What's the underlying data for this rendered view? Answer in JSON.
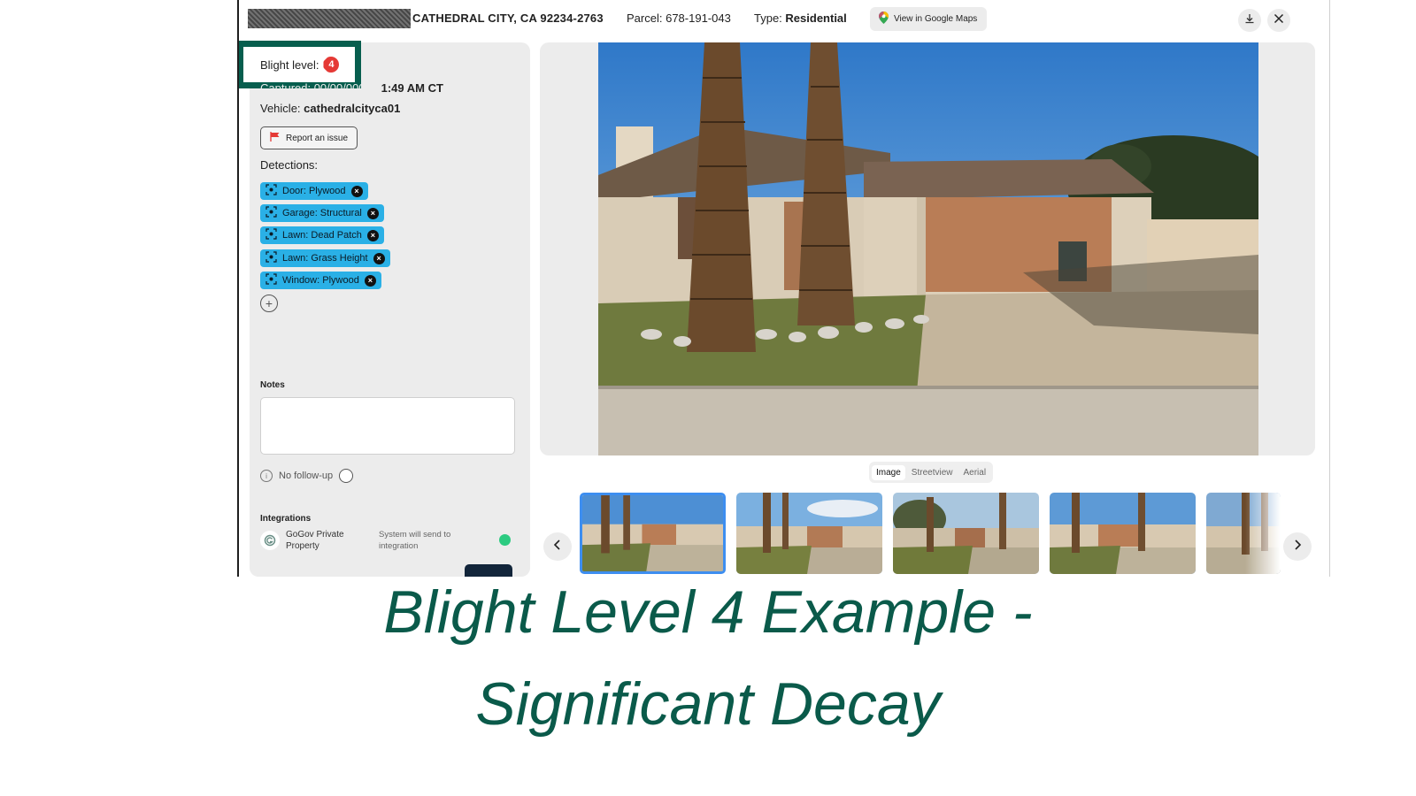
{
  "header": {
    "address": "CATHEDRAL CITY, CA 92234-2763",
    "parcel_label": "Parcel:",
    "parcel_value": "678-191-043",
    "type_label": "Type:",
    "type_value": "Residential",
    "maps_button": "View in Google Maps"
  },
  "panel": {
    "blight_label": "Blight level:",
    "blight_value": "4",
    "time_visible": "1:49 AM CT",
    "vehicle_label": "Vehicle:",
    "vehicle_value": "cathedralcityca01",
    "report_button": "Report an issue",
    "detections_label": "Detections:",
    "detections": [
      "Door: Plywood",
      "Garage: Structural",
      "Lawn: Dead Patch",
      "Lawn: Grass Height",
      "Window: Plywood"
    ],
    "notes_label": "Notes",
    "followup_label": "No follow-up",
    "integrations_label": "Integrations",
    "integration_name": "GoGov Private Property",
    "integration_desc": "System will send to integration"
  },
  "tabs": [
    "Image",
    "Streetview",
    "Aerial"
  ],
  "active_tab": "Image",
  "caption": {
    "line1": "Blight Level 4 Example -",
    "line2": "Significant Decay"
  },
  "colors": {
    "accent_green": "#075e4e",
    "chip_blue": "#2ab0e6",
    "badge_red": "#e53935",
    "status_green": "#2ccb81",
    "selected_thumb": "#3d8ef0"
  }
}
